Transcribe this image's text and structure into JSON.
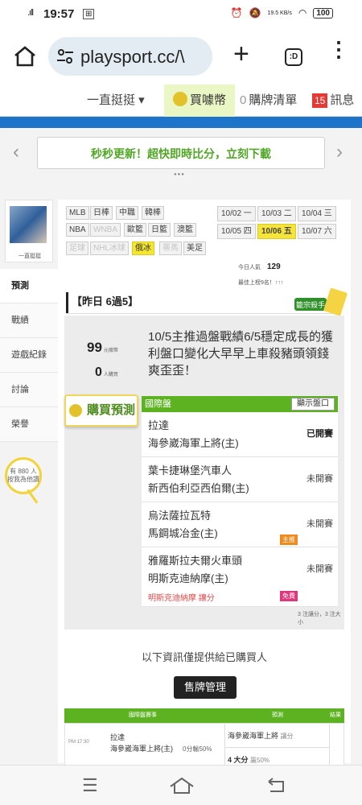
{
  "status_bar": {
    "time": "19:57",
    "signal": ".ıll",
    "net_speed": "19.5 KB/s",
    "battery": "100"
  },
  "browser": {
    "url": "playsport.cc/\\",
    "tabs_count": ":D"
  },
  "site_nav": {
    "hang": "一直挺挺 ▾",
    "buy": "買噱幣",
    "purchase_list_count": "0",
    "purchase_list": "購牌清單",
    "msg_count": "15",
    "msg": "訊息"
  },
  "banner": {
    "text": "秒秒更新！超快即時比分，立刻下載"
  },
  "profile": {
    "name": "一直挺挺"
  },
  "side_menu": [
    "預測",
    "戰績",
    "遊戲紀錄",
    "討論",
    "榮譽"
  ],
  "bulb": {
    "line1": "有 880 人",
    "line2": "按我為他讚"
  },
  "tags": [
    {
      "label": "MLB",
      "state": "normal"
    },
    {
      "label": "日棒",
      "state": "normal"
    },
    {
      "label": "中職",
      "state": "normal"
    },
    {
      "label": "韓棒",
      "state": "normal"
    },
    {
      "label": "NBA",
      "state": "normal"
    },
    {
      "label": "WNBA",
      "state": "dim"
    },
    {
      "label": "歐籃",
      "state": "normal"
    },
    {
      "label": "日籃",
      "state": "normal"
    },
    {
      "label": "澳籃",
      "state": "normal"
    },
    {
      "label": "足球",
      "state": "dim"
    },
    {
      "label": "NHL冰球",
      "state": "dim"
    },
    {
      "label": "俄冰",
      "state": "on"
    },
    {
      "label": "蒂馬",
      "state": "dim"
    },
    {
      "label": "美足",
      "state": "normal"
    }
  ],
  "dates": [
    {
      "label": "10/02 一",
      "on": false
    },
    {
      "label": "10/03 二",
      "on": false
    },
    {
      "label": "10/04 三",
      "on": false
    },
    {
      "label": "10/05 四",
      "on": false
    },
    {
      "label": "10/06 五",
      "on": true
    },
    {
      "label": "10/07 六",
      "on": false
    }
  ],
  "stats": {
    "today_label": "今日人氣",
    "today_value": "129",
    "rank_label": "最佳上榜9名！↑↑↑"
  },
  "headline": "【昨日 6過5】",
  "card": {
    "num1": "99",
    "num1_unit": "元噱幣",
    "num2": "0",
    "num2_unit": "人購買",
    "desc": "10/5主推過盤戰績6/5穩定成長的獲利盤口變化大早早上車殺豬頭領錢爽歪歪！",
    "buy_button": "購買預測",
    "table_title": "國際盤",
    "show_button": "顯示盤口",
    "rows": [
      {
        "team1": "拉達",
        "team2": "海參崴海軍上將(主)",
        "status": "已開賽",
        "done": true,
        "tag": "",
        "pick": ""
      },
      {
        "team1": "葉卡捷琳堡汽車人",
        "team2": "新西伯利亞西伯爾(主)",
        "status": "未開賽",
        "done": false,
        "tag": "",
        "pick": ""
      },
      {
        "team1": "烏法薩拉瓦特",
        "team2": "馬鋼城冶金(主)",
        "status": "未開賽",
        "done": false,
        "tag": "主推",
        "pick": ""
      },
      {
        "team1": "雅羅斯拉夫爾火車頭",
        "team2": "明斯克迪納摩(主)",
        "status": "未開賽",
        "done": false,
        "tag": "免費",
        "pick": "明斯克迪納摩 讓分"
      }
    ],
    "footer": "3 注讓分，3 注大小"
  },
  "provide_text": "以下資訊僅提供給已購買人",
  "sell_button": "售牌管理",
  "bottom_table": {
    "headers": [
      "國際盤賽事",
      "預測",
      "結果"
    ],
    "row": {
      "time": "PM 17:30",
      "team1": "拉達",
      "team2": "海參崴海軍上將(主)",
      "score": "0分輸50%",
      "pick1": "海參崴海軍上將",
      "pick1_type": "讓分",
      "pick2": "4 大分",
      "pick2_note": "贏50%"
    }
  }
}
